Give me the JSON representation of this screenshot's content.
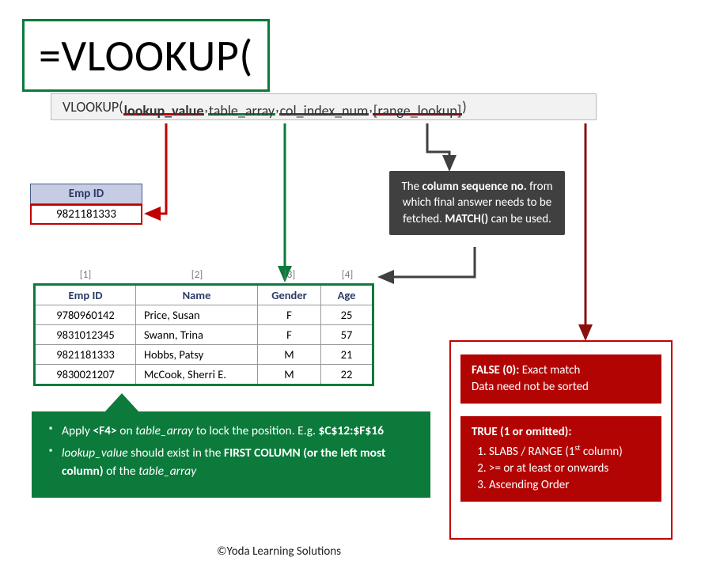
{
  "formula": "=VLOOKUP(",
  "tooltip": {
    "fn": "VLOOKUP(",
    "arg1": "lookup_value",
    "arg2": "table_array",
    "arg3": "col_index_num",
    "arg4": "[range_lookup]",
    "close": ")"
  },
  "emp_header": "Emp ID",
  "emp_value": "9821181333",
  "colseq_html": "The <b>column sequence no.</b> from which final answer needs to be fetched. <b>MATCH()</b> can be used.",
  "colnums": {
    "c1": "[1]",
    "c2": "[2]",
    "c3": "[3]",
    "c4": "[4]"
  },
  "table": {
    "headers": {
      "c1": "Emp ID",
      "c2": "Name",
      "c3": "Gender",
      "c4": "Age"
    },
    "rows": [
      {
        "id": "9780960142",
        "name": "Price, Susan",
        "gender": "F",
        "age": "25"
      },
      {
        "id": "9831012345",
        "name": "Swann, Trina",
        "gender": "F",
        "age": "57"
      },
      {
        "id": "9821181333",
        "name": "Hobbs, Patsy",
        "gender": "M",
        "age": "21"
      },
      {
        "id": "9830021207",
        "name": "McCook, Sherri E.",
        "gender": "M",
        "age": "22"
      }
    ]
  },
  "green_tip_1": "Apply <b>&lt;F4&gt;</b> on <i>table_array</i> to lock the position. E.g. <b>$C$12:$F$16</b>",
  "green_tip_2": "<i>lookup_value</i> should exist in the <b>FIRST COLUMN (or the left most column)</b> of the <i>table_array</i>",
  "rl_false": "<b>FALSE (0):</b> Exact match<br>Data need not be sorted",
  "rl_true_head": "TRUE (1 or omitted):",
  "rl_true_items": [
    "SLABS / RANGE (1<span class='sup'>st</span> column)",
    ">= or at least or onwards",
    "Ascending Order"
  ],
  "copyright": "©Yoda Learning Solutions"
}
